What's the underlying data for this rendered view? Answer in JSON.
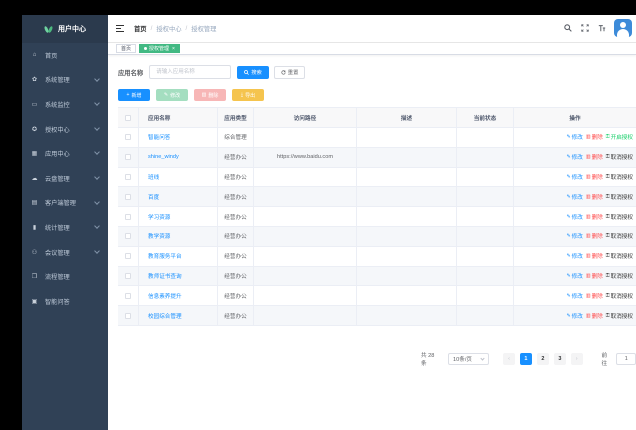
{
  "sidebar": {
    "title": "用户中心",
    "items": [
      {
        "label": "首页",
        "icon": "home-icon",
        "arrow": false
      },
      {
        "label": "系统管理",
        "icon": "gear-icon",
        "arrow": true
      },
      {
        "label": "系统监控",
        "icon": "monitor-icon",
        "arrow": true
      },
      {
        "label": "授权中心",
        "icon": "shield-gear-icon",
        "arrow": true
      },
      {
        "label": "应用中心",
        "icon": "grid-icon",
        "arrow": true
      },
      {
        "label": "云盘管理",
        "icon": "cloud-icon",
        "arrow": true
      },
      {
        "label": "客户端管理",
        "icon": "client-icon",
        "arrow": true
      },
      {
        "label": "统计管理",
        "icon": "chart-icon",
        "arrow": true
      },
      {
        "label": "会议管理",
        "icon": "people-icon",
        "arrow": true
      },
      {
        "label": "流程管理",
        "icon": "flow-icon",
        "arrow": false
      },
      {
        "label": "智能问答",
        "icon": "qa-icon",
        "arrow": false
      }
    ]
  },
  "breadcrumb": {
    "home": "首页",
    "sep": "/",
    "level1": "授权中心",
    "level2": "授权管理"
  },
  "tags": {
    "home": "首页",
    "current": "授权管理",
    "close": "×"
  },
  "search": {
    "label": "应用名称",
    "placeholder": "请输入应用名称",
    "search_label": "搜索",
    "reset_label": "重置"
  },
  "toolbar": {
    "add": "新增",
    "edit": "修改",
    "delete": "删除",
    "export": "导出"
  },
  "table": {
    "headers": {
      "name": "应用名称",
      "type": "应用类型",
      "path": "访问路径",
      "desc": "描述",
      "status": "当前状态",
      "ops": "操作"
    },
    "rows": [
      {
        "name": "智能问答",
        "type": "综合管理",
        "path": "",
        "ops": [
          "修改",
          "删除",
          "开启授权"
        ],
        "grant": true
      },
      {
        "name": "shine_windy",
        "type": "经营办公",
        "path": "https://www.baidu.com",
        "ops": [
          "修改",
          "删除",
          "取消授权"
        ],
        "grant": false
      },
      {
        "name": "班线",
        "type": "经营办公",
        "path": "",
        "ops": [
          "修改",
          "删除",
          "取消授权"
        ],
        "grant": false
      },
      {
        "name": "百度",
        "type": "经营办公",
        "path": "",
        "ops": [
          "修改",
          "删除",
          "取消授权"
        ],
        "grant": false
      },
      {
        "name": "学习资源",
        "type": "经营办公",
        "path": "",
        "ops": [
          "修改",
          "删除",
          "取消授权"
        ],
        "grant": false
      },
      {
        "name": "教学资源",
        "type": "经营办公",
        "path": "",
        "ops": [
          "修改",
          "删除",
          "取消授权"
        ],
        "grant": false
      },
      {
        "name": "教育服务平台",
        "type": "经营办公",
        "path": "",
        "ops": [
          "修改",
          "删除",
          "取消授权"
        ],
        "grant": false
      },
      {
        "name": "教师证书查询",
        "type": "经营办公",
        "path": "",
        "ops": [
          "修改",
          "删除",
          "取消授权"
        ],
        "grant": false
      },
      {
        "name": "信息素养提升",
        "type": "经营办公",
        "path": "",
        "ops": [
          "修改",
          "删除",
          "取消授权"
        ],
        "grant": false
      },
      {
        "name": "校园综合管理",
        "type": "经营办公",
        "path": "",
        "ops": [
          "修改",
          "删除",
          "取消授权"
        ],
        "grant": false
      }
    ]
  },
  "pagination": {
    "total": "共 28 条",
    "page_size": "10条/页",
    "pages": [
      "1",
      "2",
      "3"
    ],
    "current": "1",
    "prev": "‹",
    "next": "›",
    "goto_label": "前往",
    "goto_value": "1"
  },
  "colors": {
    "sidebar_bg": "#304156",
    "primary": "#1890ff",
    "tag_active": "#42b983",
    "danger": "#ff4949",
    "success": "#13ce66"
  }
}
